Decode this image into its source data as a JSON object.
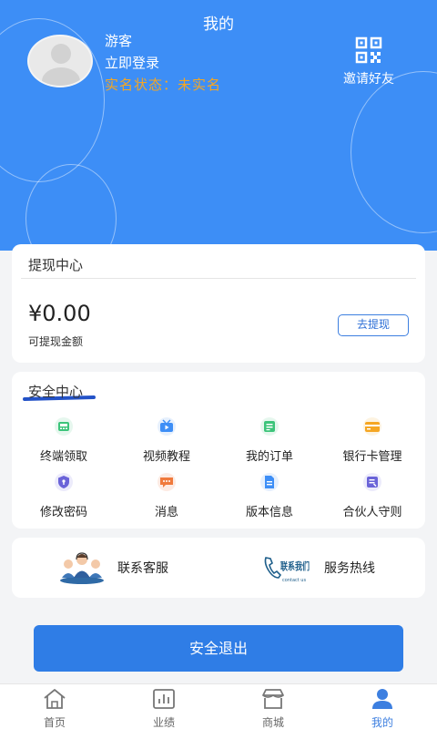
{
  "header": {
    "title": "我的",
    "username": "游客",
    "login_link": "立即登录",
    "realname_status": "实名状态：未实名",
    "invite_label": "邀请好友"
  },
  "withdraw": {
    "title": "提现中心",
    "amount": "¥0.00",
    "amount_label": "可提现金额",
    "button_label": "去提现"
  },
  "security": {
    "title": "安全中心",
    "items": [
      {
        "label": "终端领取",
        "icon": "terminal-icon"
      },
      {
        "label": "视频教程",
        "icon": "video-icon"
      },
      {
        "label": "我的订单",
        "icon": "order-icon"
      },
      {
        "label": "银行卡管理",
        "icon": "bank-card-icon"
      },
      {
        "label": "修改密码",
        "icon": "shield-icon"
      },
      {
        "label": "消息",
        "icon": "message-icon"
      },
      {
        "label": "版本信息",
        "icon": "document-icon"
      },
      {
        "label": "合伙人守则",
        "icon": "rules-icon"
      }
    ]
  },
  "contact": {
    "service_label": "联系客服",
    "hotline_label": "服务热线",
    "logo_text": "联系我们",
    "logo_subtext": "contact us"
  },
  "logout_label": "安全退出",
  "tabbar": {
    "items": [
      {
        "label": "首页",
        "icon": "home-icon"
      },
      {
        "label": "业绩",
        "icon": "chart-icon"
      },
      {
        "label": "商城",
        "icon": "store-icon"
      },
      {
        "label": "我的",
        "icon": "user-icon"
      }
    ],
    "active_index": 3
  },
  "colors": {
    "header_bg": "#3d8ef6",
    "accent": "#2f7de6",
    "warning": "#f5a623"
  }
}
